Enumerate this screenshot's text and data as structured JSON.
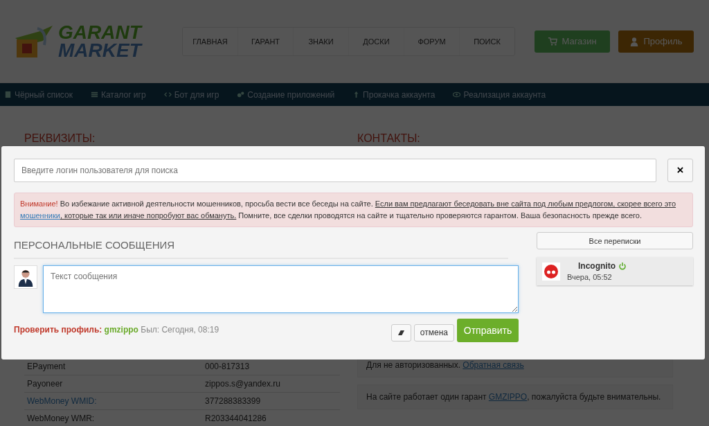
{
  "header": {
    "logo": {
      "line_1": "GARANT",
      "line_2": "MARKET"
    },
    "menu": [
      "ГЛАВНАЯ",
      "ГАРАНТ",
      "ЗНАКИ",
      "ДОСКИ",
      "ФОРУМ",
      "ПОИСК"
    ],
    "buttons": [
      {
        "label": "Магазин",
        "kind": "shop"
      },
      {
        "label": "Профиль",
        "kind": "profile"
      }
    ]
  },
  "category_bar": [
    {
      "label": "Чёрный список",
      "kind": "book"
    },
    {
      "label": "Каталог игр",
      "kind": "list"
    },
    {
      "label": "Бот для игр",
      "kind": "code"
    },
    {
      "label": "Создание приложений",
      "kind": "gears"
    },
    {
      "label": "Прокачка аккаунта",
      "kind": "arrow"
    },
    {
      "label": "Реализация аккаунта",
      "kind": "eye"
    }
  ],
  "requisites": {
    "title": "РЕКВИЗИТЫ:",
    "rows": [
      {
        "label": "EPayment",
        "value": "000-817313",
        "is_link": false
      },
      {
        "label": "Payoneer",
        "value": "zippos.s@yandex.ru",
        "is_link": false
      },
      {
        "label": "WebMoney WMID:",
        "value": "377288383399",
        "is_link": true
      },
      {
        "label": "WebMoney WMR:",
        "value": "R203344041286",
        "is_link": false
      }
    ]
  },
  "contacts": {
    "title": "КОНТАКТЫ:",
    "boxes": [
      {
        "text": "Для не авторизованных.",
        "link": "Обратная связь"
      },
      {
        "text": "На сайте работает один гарант",
        "link": "GMZIPPO",
        "after": ", пожалуйста будьте внимательны."
      }
    ]
  },
  "modal": {
    "search": {
      "placeholder": "Введите логин пользователя для поиска"
    },
    "close": "×",
    "alert": {
      "label": "Внимание!",
      "text_1": "Во избежание активной деятельности мошенников, просьба вести все беседы на сайте.",
      "underlined_1": "Если вам предлагают беседовать вне сайта под любым предлогом, скорее всего это",
      "link": "мошенники",
      "underlined_2": ", которые так или иначе попробуют вас обмануть.",
      "text_2": "Помните, все сделки проводятся на сайте и тщательно проверяются гарантом. Ваша безопасность прежде всего."
    },
    "heading": "ПЕРСОНАЛЬНЫЕ СООБЩЕНИЯ",
    "message": {
      "placeholder": "Текст сообщения"
    },
    "profile_line": {
      "label": "Проверить профиль:",
      "user": "gmzippo",
      "seen": "Был: Сегодня, 08:19"
    },
    "cancel": "отмена",
    "send": "Отправить",
    "all_chats": "Все переписки",
    "conversations": [
      {
        "name": "Incognito",
        "online": true,
        "time": "Вчера, 05:52"
      }
    ]
  }
}
